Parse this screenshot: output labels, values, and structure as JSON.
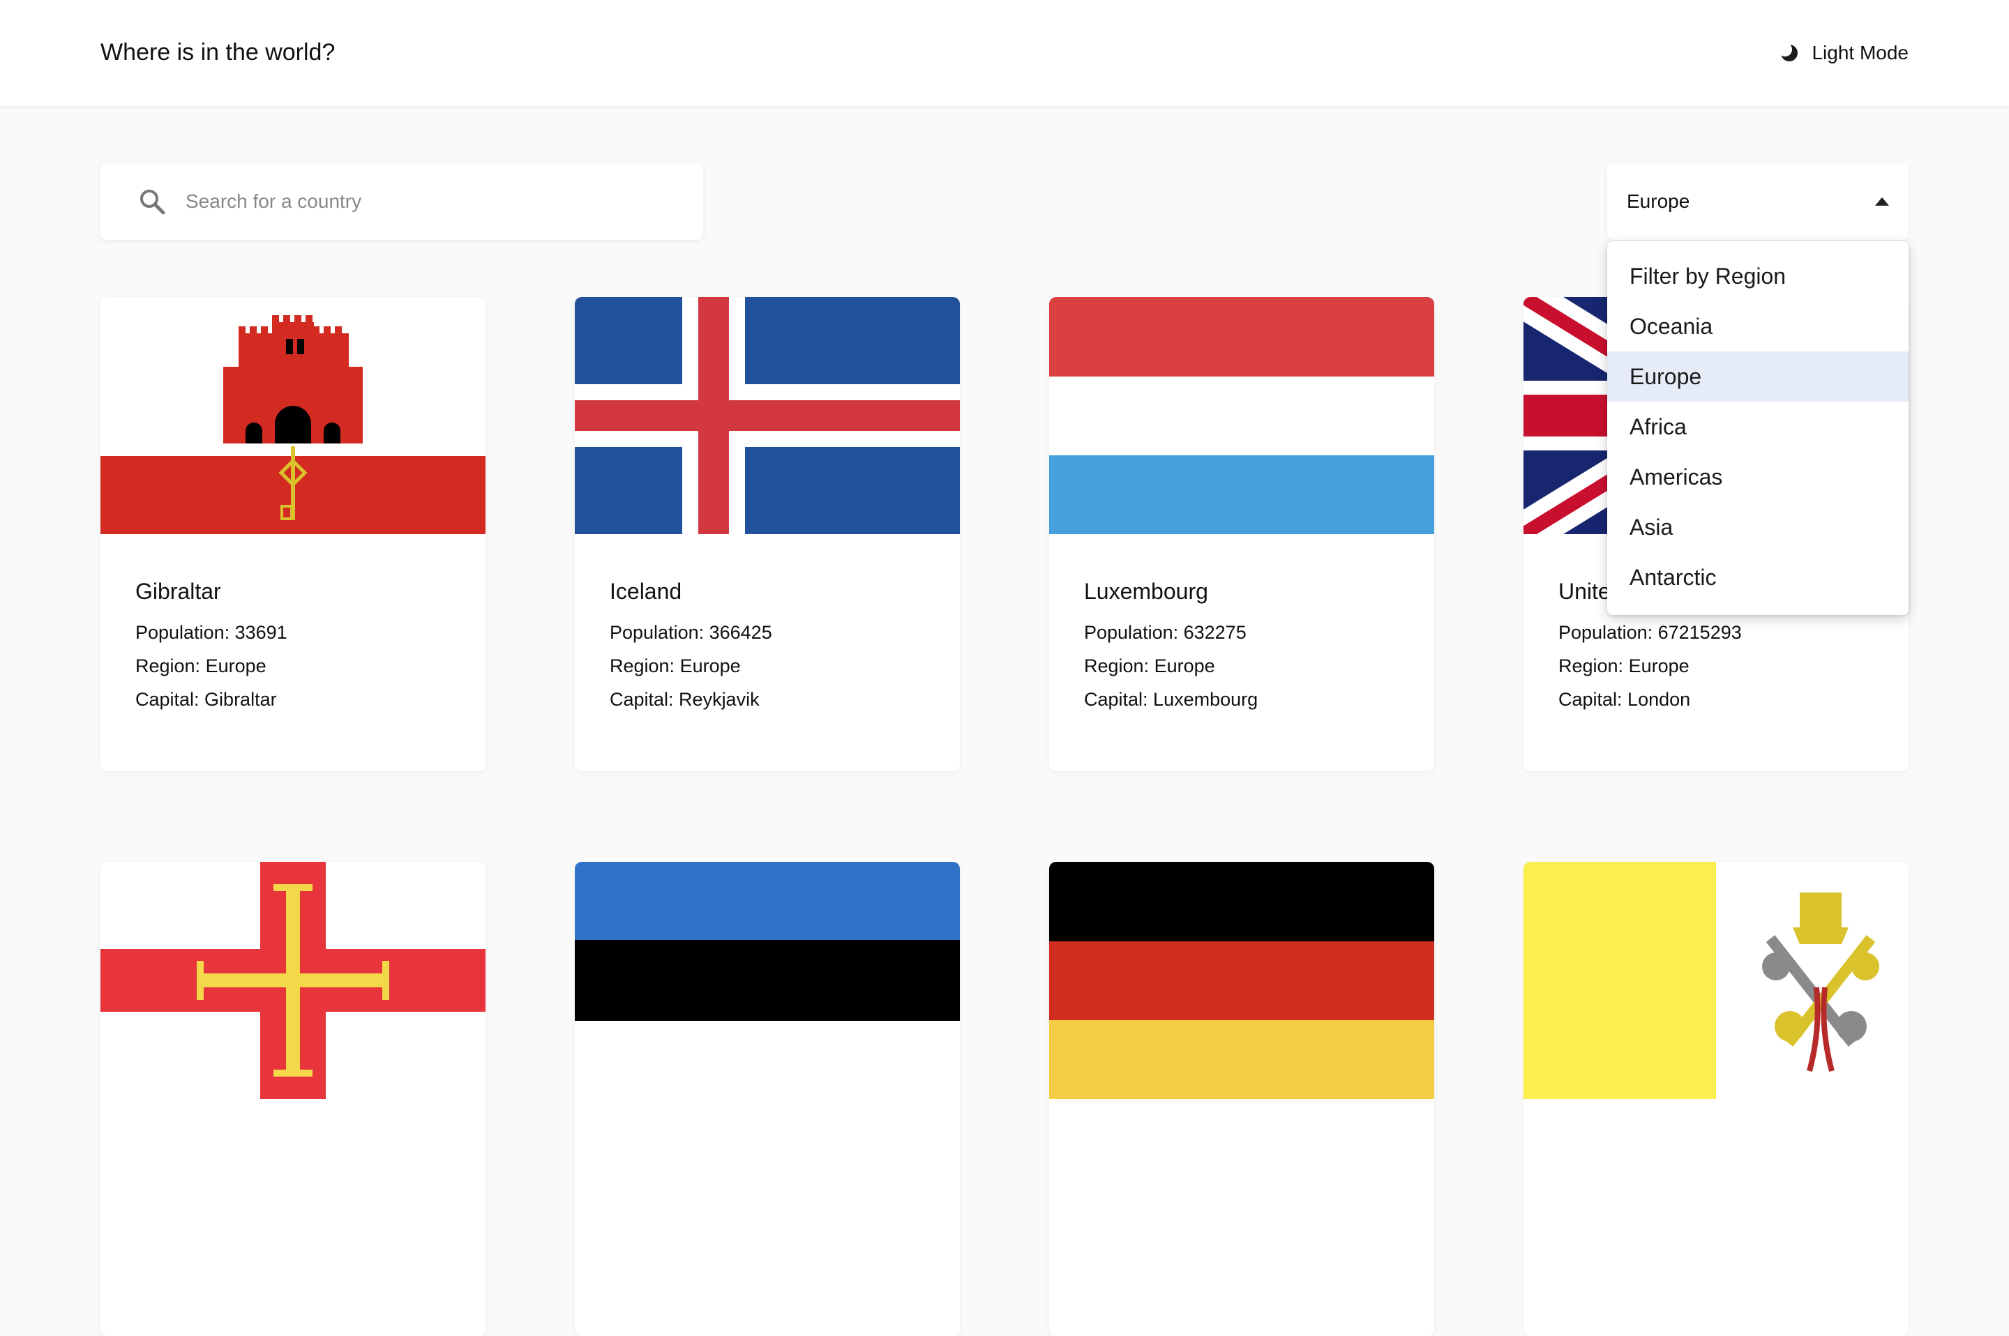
{
  "header": {
    "title": "Where is in the world?",
    "theme_toggle_label": "Light Mode"
  },
  "search": {
    "placeholder": "Search for a country",
    "value": ""
  },
  "region_filter": {
    "selected": "Europe",
    "options": [
      "Filter by Region",
      "Oceania",
      "Europe",
      "Africa",
      "Americas",
      "Asia",
      "Antarctic"
    ],
    "highlighted": "Europe"
  },
  "countries": [
    {
      "name": "Gibraltar",
      "population": "Population: 33691",
      "region": "Region: Europe",
      "capital": "Capital: Gibraltar"
    },
    {
      "name": "Iceland",
      "population": "Population: 366425",
      "region": "Region: Europe",
      "capital": "Capital: Reykjavik"
    },
    {
      "name": "Luxembourg",
      "population": "Population: 632275",
      "region": "Region: Europe",
      "capital": "Capital: Luxembourg"
    },
    {
      "name": "Unite",
      "population": "Population: 67215293",
      "region": "Region: Europe",
      "capital": "Capital: London"
    }
  ],
  "colors": {
    "background": "#fafafa",
    "card": "#ffffff",
    "selected_option": "#e6ecf7"
  },
  "icons": {
    "theme": "moon-icon",
    "search": "search-icon",
    "dropdown": "caret-up-icon"
  }
}
